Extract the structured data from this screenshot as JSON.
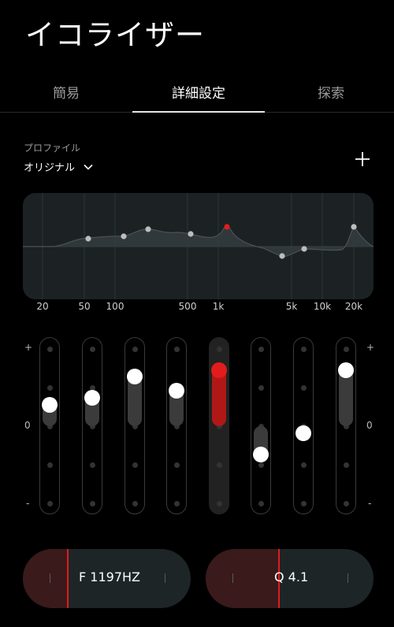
{
  "app": {
    "title": "イコライザー"
  },
  "tabs": [
    {
      "label": "簡易",
      "active": false
    },
    {
      "label": "詳細設定",
      "active": true
    },
    {
      "label": "探索",
      "active": false
    }
  ],
  "profile": {
    "label": "プロファイル",
    "value": "オリジナル"
  },
  "add_icon": "plus-icon",
  "graph": {
    "frequency_labels": [
      "20",
      "50",
      "100",
      "500",
      "1k",
      "5k",
      "10k",
      "20k"
    ]
  },
  "scale": {
    "top": "+",
    "mid": "0",
    "bottom": "-"
  },
  "bands": [
    {
      "level": 0.27,
      "selected": false
    },
    {
      "level": 0.36,
      "selected": false
    },
    {
      "level": 0.64,
      "selected": false
    },
    {
      "level": 0.45,
      "selected": false
    },
    {
      "level": 0.72,
      "selected": true
    },
    {
      "level": -0.36,
      "selected": false
    },
    {
      "level": -0.09,
      "selected": false
    },
    {
      "level": 0.72,
      "selected": false
    }
  ],
  "controls": {
    "frequency": "F 1197HZ",
    "q": "Q 4.1"
  },
  "colors": {
    "accent": "#e21c1c",
    "background": "#000000",
    "panel": "#1c2224"
  }
}
